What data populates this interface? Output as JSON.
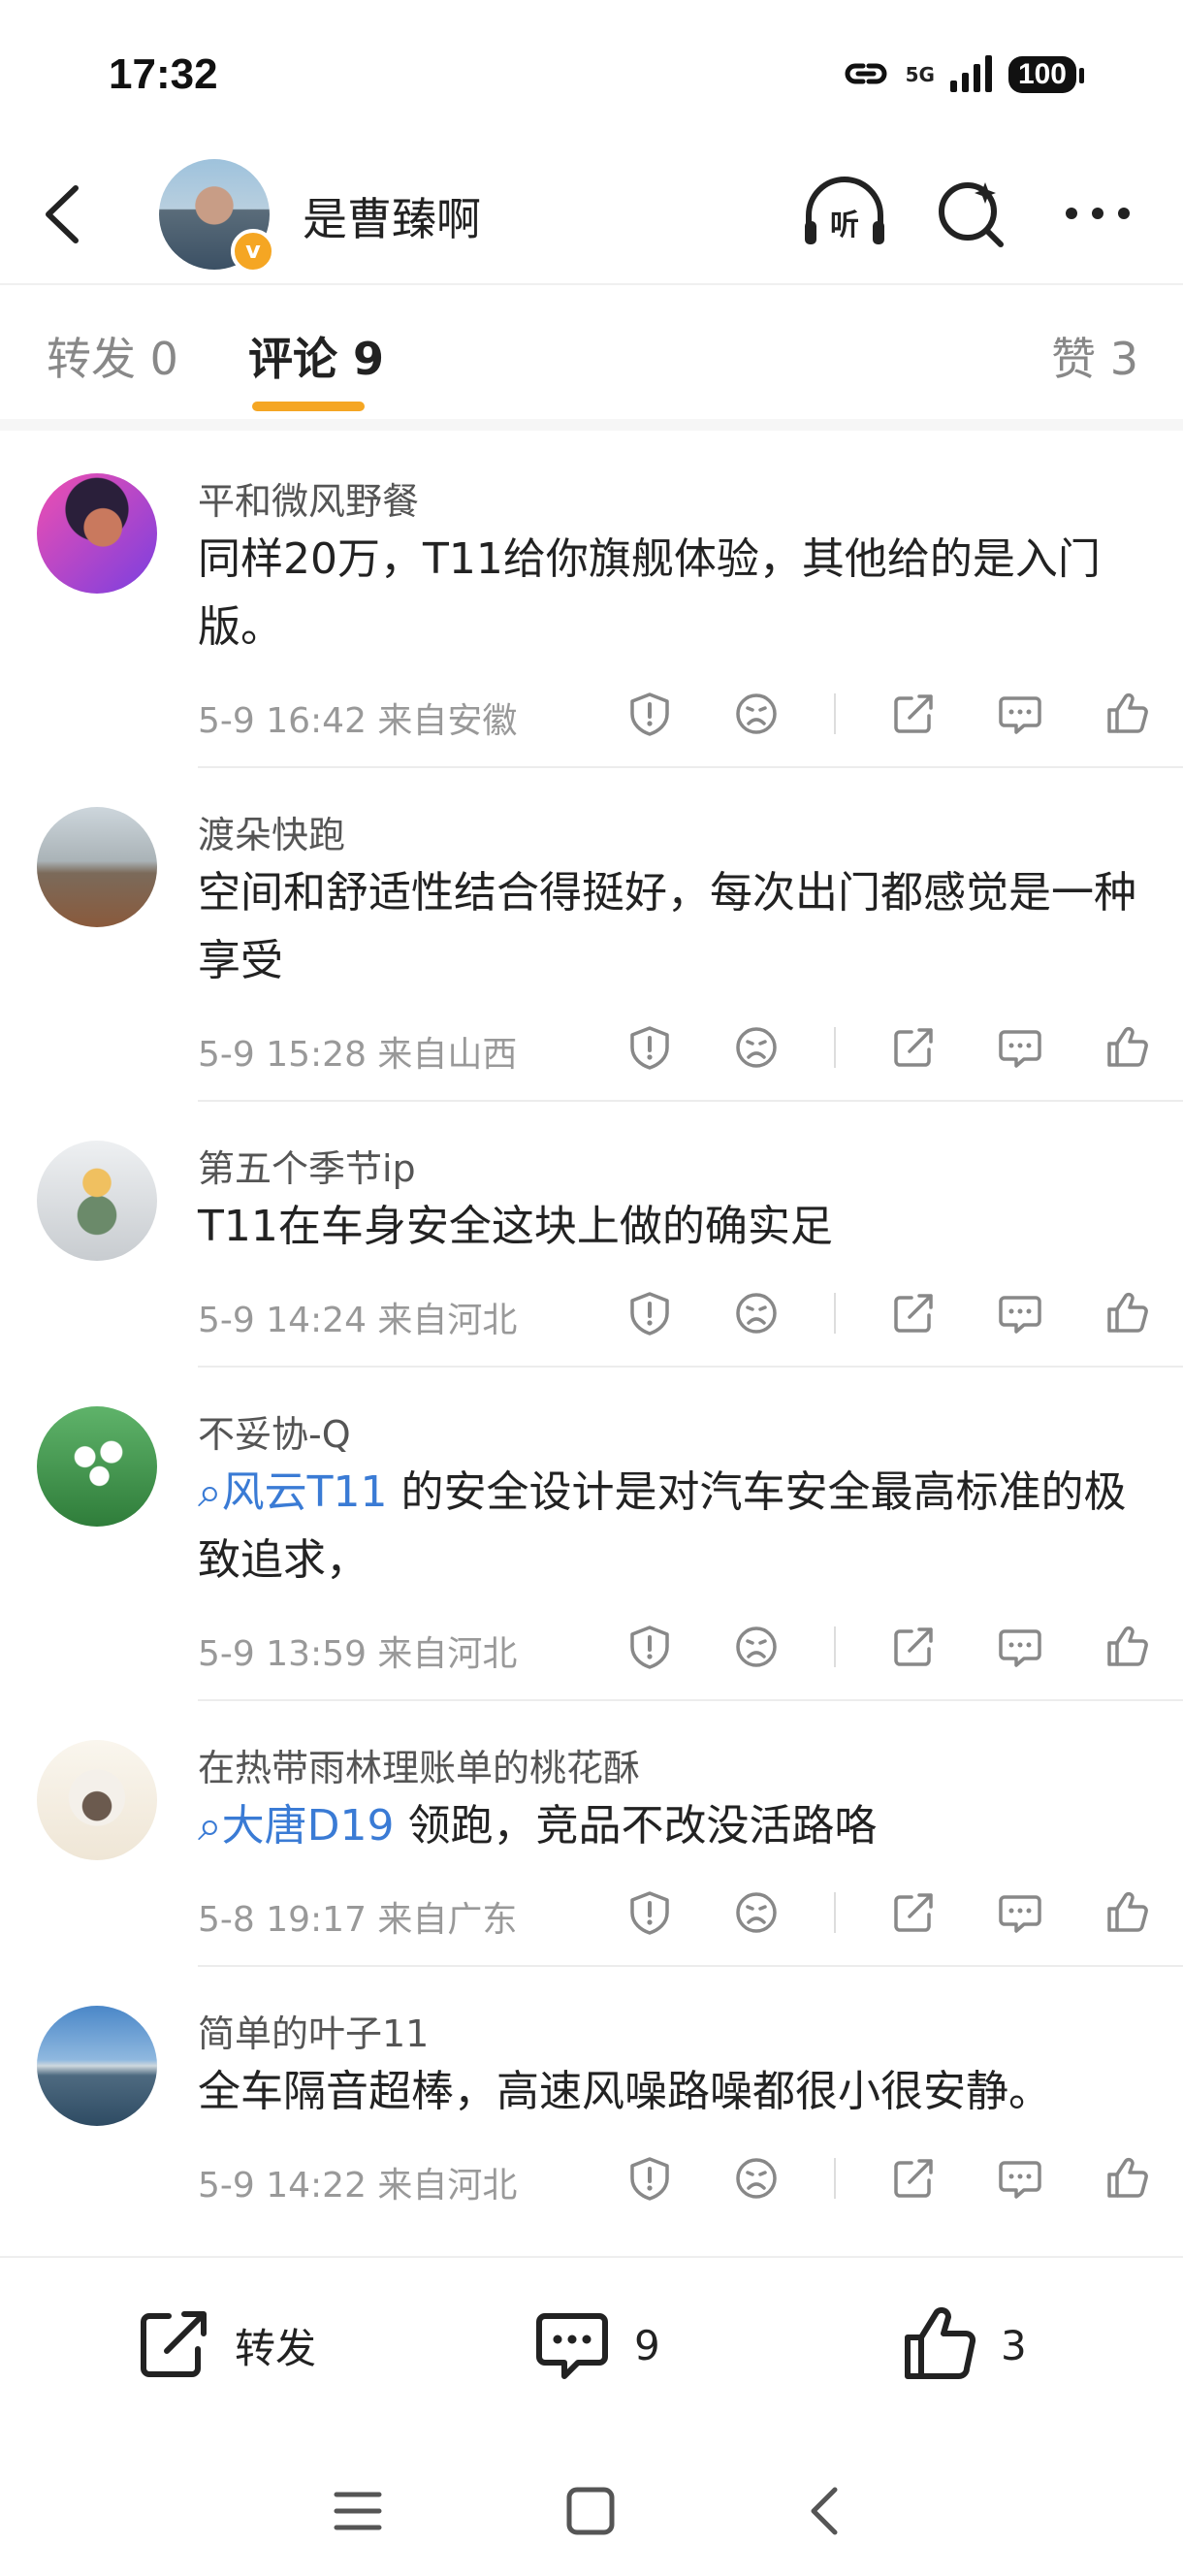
{
  "status_bar": {
    "time": "17:32",
    "network": "5G",
    "battery": "100"
  },
  "header": {
    "username": "是曹臻啊",
    "listen_label": "听"
  },
  "tabs": [
    {
      "label": "转发 0"
    },
    {
      "label": "评论 9"
    },
    {
      "label": "赞 3"
    }
  ],
  "colors": {
    "accent": "#f5a623",
    "link": "#3a7bd5"
  },
  "comments": [
    {
      "name": "平和微风野餐",
      "text_link": "",
      "text": "同样20万，T11给你旗舰体验，其他给的是入门版。",
      "meta": "5-9 16:42 来自安徽"
    },
    {
      "name": "渡朵快跑",
      "text_link": "",
      "text": "空间和舒适性结合得挺好，每次出门都感觉是一种享受",
      "meta": "5-9 15:28 来自山西"
    },
    {
      "name": "第五个季节ip",
      "text_link": "",
      "text": "T11在车身安全这块上做的确实足",
      "meta": "5-9 14:24 来自河北"
    },
    {
      "name": "不妥协-Q",
      "text_link": "风云T11",
      "text": " 的安全设计是对汽车安全最高标准的极致追求，",
      "meta": "5-9 13:59 来自河北"
    },
    {
      "name": "在热带雨林理账单的桃花酥",
      "text_link": "大唐D19",
      "text": " 领跑，竞品不改没活路咯",
      "meta": "5-8 19:17 来自广东"
    },
    {
      "name": "简单的叶子11",
      "text_link": "",
      "text": "全车隔音超棒，高速风噪路噪都很小很安静。",
      "meta": "5-9 14:22 来自河北"
    }
  ],
  "bottom_bar": {
    "repost_label": "转发",
    "comment_count": "9",
    "like_count": "3"
  }
}
